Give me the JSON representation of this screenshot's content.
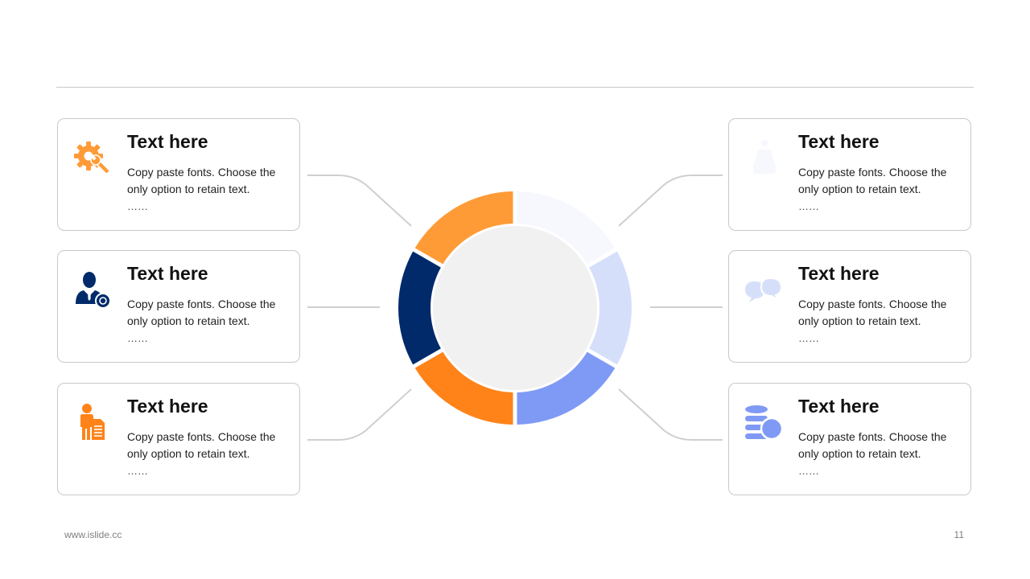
{
  "colors": {
    "orange_light": "#FF9B36",
    "orange": "#FF8319",
    "navy": "#002A6A",
    "periwinkle": "#7F9AF5",
    "lavender": "#D6DFFA",
    "pale": "#F6F8FE",
    "center_fill": "#F1F1F1",
    "connector": "#CFCFCF"
  },
  "cards": [
    {
      "title": "Text here",
      "body": "Copy paste fonts. Choose the only option to retain text.",
      "dots": "……",
      "icon": "gear-wrench-icon"
    },
    {
      "title": "Text here",
      "body": "Copy paste fonts. Choose the only option to retain text.",
      "dots": "……",
      "icon": "businessman-coin-icon"
    },
    {
      "title": "Text here",
      "body": "Copy paste fonts. Choose the only option to retain text.",
      "dots": "……",
      "icon": "person-document-icon"
    },
    {
      "title": "Text here",
      "body": "Copy paste fonts. Choose the only option to retain text.",
      "dots": "……",
      "icon": "hand-money-icon"
    },
    {
      "title": "Text here",
      "body": "Copy paste fonts. Choose the only option to retain text.",
      "dots": "……",
      "icon": "chat-bubbles-icon"
    },
    {
      "title": "Text here",
      "body": "Copy paste fonts. Choose the only option to retain text.",
      "dots": "……",
      "icon": "coins-stack-icon"
    }
  ],
  "footer": {
    "url": "www.islide.cc",
    "page": "11"
  }
}
